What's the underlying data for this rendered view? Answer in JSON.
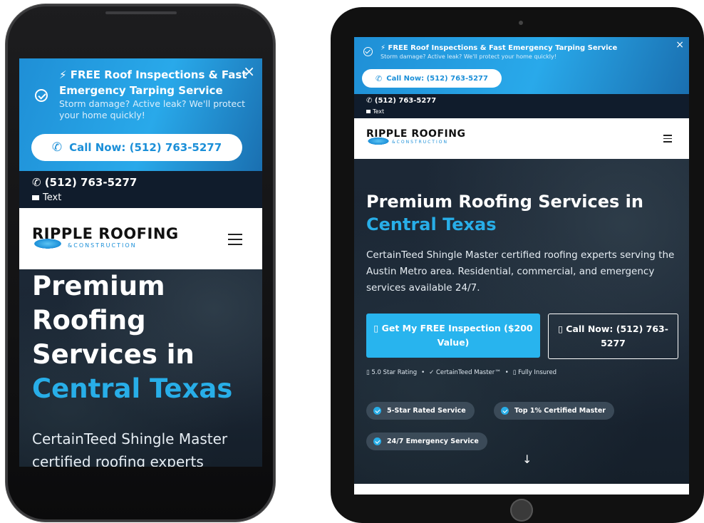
{
  "alert": {
    "title": "⚡ FREE Roof Inspections & Fast Emergency Tarping Service",
    "subtitle": "Storm damage? Active leak? We'll protect your home quickly!",
    "call_button": "Call Now: (512) 763-5277",
    "close_label": "×",
    "phone_icon": "phone-icon",
    "check_icon": "check-circle-icon"
  },
  "topbar": {
    "phone": "(512) 763-5277",
    "text_label": "Text"
  },
  "nav": {
    "logo_brand": "RIPPLE ROOFING",
    "logo_sub": "&CONSTRUCTION",
    "menu_icon": "hamburger-icon"
  },
  "hero": {
    "title_line": "Premium Roofing Services in",
    "title_accent": "Central Texas",
    "lead": "CertainTeed Shingle Master certified roofing experts serving the Austin Metro area. Residential, commercial, and emergency services available 24/7.",
    "lead_phone_visible": "CertainTeed Shingle Master certified roofing experts",
    "primary_button": "▯ Get My FREE Inspection ($200 Value)",
    "outline_button": "▯ Call Now: (512) 763-5277",
    "trust": [
      "▯ 5.0 Star Rating",
      "•",
      "✓ CertainTeed Master™",
      "•",
      "▯ Fully Insured"
    ],
    "badges": [
      "5-Star Rated Service",
      "Top 1% Certified Master",
      "24/7 Emergency Service"
    ],
    "scroll_arrow": "↓"
  },
  "colors": {
    "accent": "#28aee8",
    "alert_blue": "#1f8fd6",
    "topbar": "#101c2c",
    "hero_bg": "#1c2836"
  }
}
